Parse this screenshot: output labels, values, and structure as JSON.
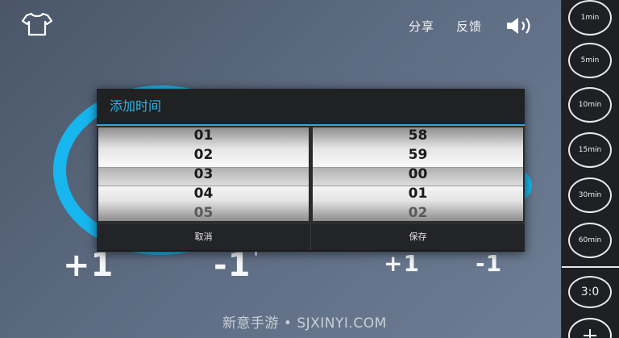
{
  "topbar": {
    "share_label": "分享",
    "feedback_label": "反馈"
  },
  "adjust": {
    "plus_big": "+1",
    "minus_big": "-1",
    "plus_small": "+1",
    "minus_small": "-1",
    "tick": "'"
  },
  "dialog": {
    "title": "添加时间",
    "left_wheel": [
      "01",
      "02",
      "03",
      "04",
      "05"
    ],
    "right_wheel": [
      "58",
      "59",
      "00",
      "01",
      "02"
    ],
    "cancel_label": "取消",
    "save_label": "保存"
  },
  "watermark": "新意手游 • SJXINYI.COM",
  "sidebar": {
    "presets": [
      "1min",
      "5min",
      "10min",
      "15min",
      "30min",
      "60min"
    ],
    "custom": "3:0"
  },
  "colors": {
    "accent": "#17b6ee",
    "title": "#2fb5e6",
    "sidebar": "#1e2024"
  }
}
